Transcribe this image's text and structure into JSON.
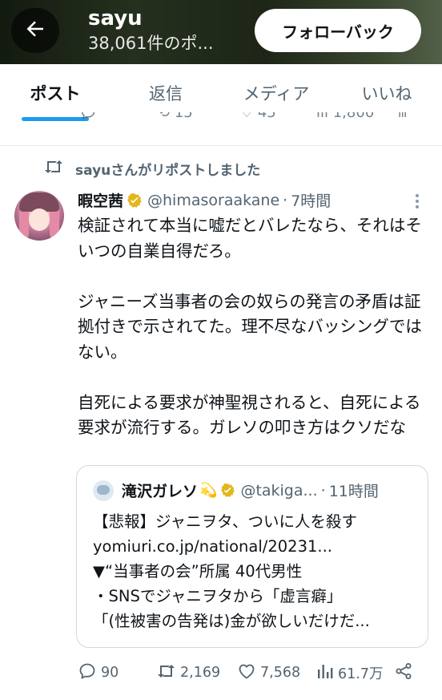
{
  "header": {
    "name": "sayu",
    "post_count": "38,061件のポ...",
    "follow_button": "フォローバック"
  },
  "tabs": [
    {
      "label": "ポスト",
      "active": true
    },
    {
      "label": "返信",
      "active": false
    },
    {
      "label": "メディア",
      "active": false
    },
    {
      "label": "いいね",
      "active": false
    }
  ],
  "prev_actions": {
    "retweets": "15",
    "likes": "45",
    "views": "1,800"
  },
  "repost_notice": "sayuさんがリポストしました",
  "tweet": {
    "display_name": "暇空茜",
    "handle": "@himasoraakane",
    "separator": "·",
    "time": "7時間",
    "text": "検証されて本当に嘘だとバレたなら、それはそいつの自業自得だろ。\n\nジャニーズ当事者の会の奴らの発言の矛盾は証拠付きで示されてた。理不尽なバッシングではない。\n\n自死による要求が神聖視されると、自死による要求が流行する。ガレソの叩き方はクソだな"
  },
  "quote": {
    "display_name": "滝沢ガレソ",
    "emoji": "💫",
    "handle": "@takiga...",
    "separator": "·",
    "time": "11時間",
    "lines": [
      "【悲報】ジャニヲタ、ついに人を殺す",
      "yomiuri.co.jp/national/20231...",
      "▼“当事者の会”所属 40代男性",
      "・SNSでジャニヲタから「虚言癖」",
      "「(性被害の告発は)金が欲しいだけだ..."
    ]
  },
  "actions": {
    "replies": "90",
    "reposts": "2,169",
    "likes": "7,568",
    "views": "61.7万"
  },
  "colors": {
    "accent": "#1d9bf0",
    "secondary_text": "#536471",
    "primary_text": "#0f1419",
    "verified_gold": "#e2b719"
  },
  "icons": [
    "back-arrow-icon",
    "retweet-icon",
    "verified-badge-icon",
    "more-icon",
    "reply-icon",
    "like-icon",
    "views-icon",
    "share-icon"
  ]
}
